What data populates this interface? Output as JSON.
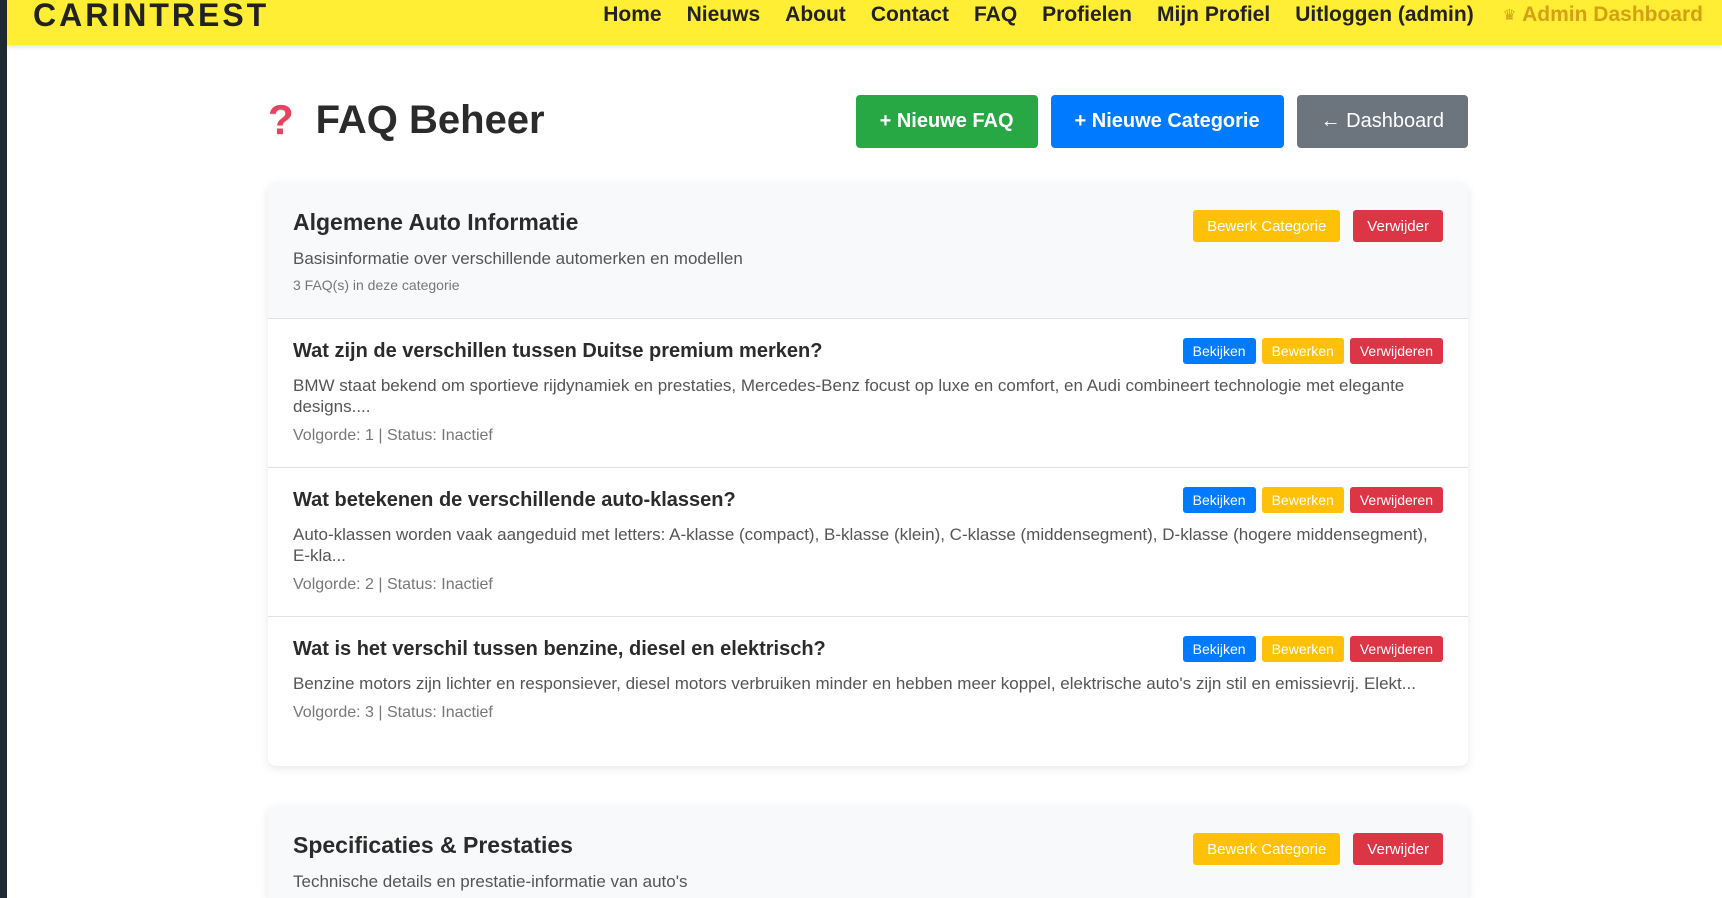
{
  "navbar": {
    "brand": "CARINTREST",
    "links": [
      "Home",
      "Nieuws",
      "About",
      "Contact",
      "FAQ",
      "Profielen",
      "Mijn Profiel",
      "Uitloggen (admin)"
    ],
    "admin_icon": "crown-icon",
    "admin_label": "Admin Dashboard"
  },
  "header": {
    "icon": "question-icon",
    "icon_glyph": "❓",
    "title": "FAQ Beheer",
    "new_faq": "+ Nieuwe FAQ",
    "new_category": "+ Nieuwe Categorie",
    "dashboard": "← Dashboard"
  },
  "category_actions": {
    "edit": "Bewerk Categorie",
    "delete": "Verwijder"
  },
  "faq_actions": {
    "view": "Bekijken",
    "edit": "Bewerken",
    "delete": "Verwijderen"
  },
  "categories": [
    {
      "title": "Algemene Auto Informatie",
      "description": "Basisinformatie over verschillende automerken en modellen",
      "count": "3 FAQ(s) in deze categorie",
      "faqs": [
        {
          "question": "Wat zijn de verschillen tussen Duitse premium merken?",
          "answer": "BMW staat bekend om sportieve rijdynamiek en prestaties, Mercedes-Benz focust op luxe en comfort, en Audi combineert technologie met elegante designs....",
          "meta": "Volgorde: 1 | Status: Inactief"
        },
        {
          "question": "Wat betekenen de verschillende auto-klassen?",
          "answer": "Auto-klassen worden vaak aangeduid met letters: A-klasse (compact), B-klasse (klein), C-klasse (middensegment), D-klasse (hogere middensegment), E-kla...",
          "meta": "Volgorde: 2 | Status: Inactief"
        },
        {
          "question": "Wat is het verschil tussen benzine, diesel en elektrisch?",
          "answer": "Benzine motors zijn lichter en responsiever, diesel motors verbruiken minder en hebben meer koppel, elektrische auto's zijn stil en emissievrij. Elekt...",
          "meta": "Volgorde: 3 | Status: Inactief"
        }
      ]
    },
    {
      "title": "Specificaties & Prestaties",
      "description": "Technische details en prestatie-informatie van auto's"
    }
  ]
}
